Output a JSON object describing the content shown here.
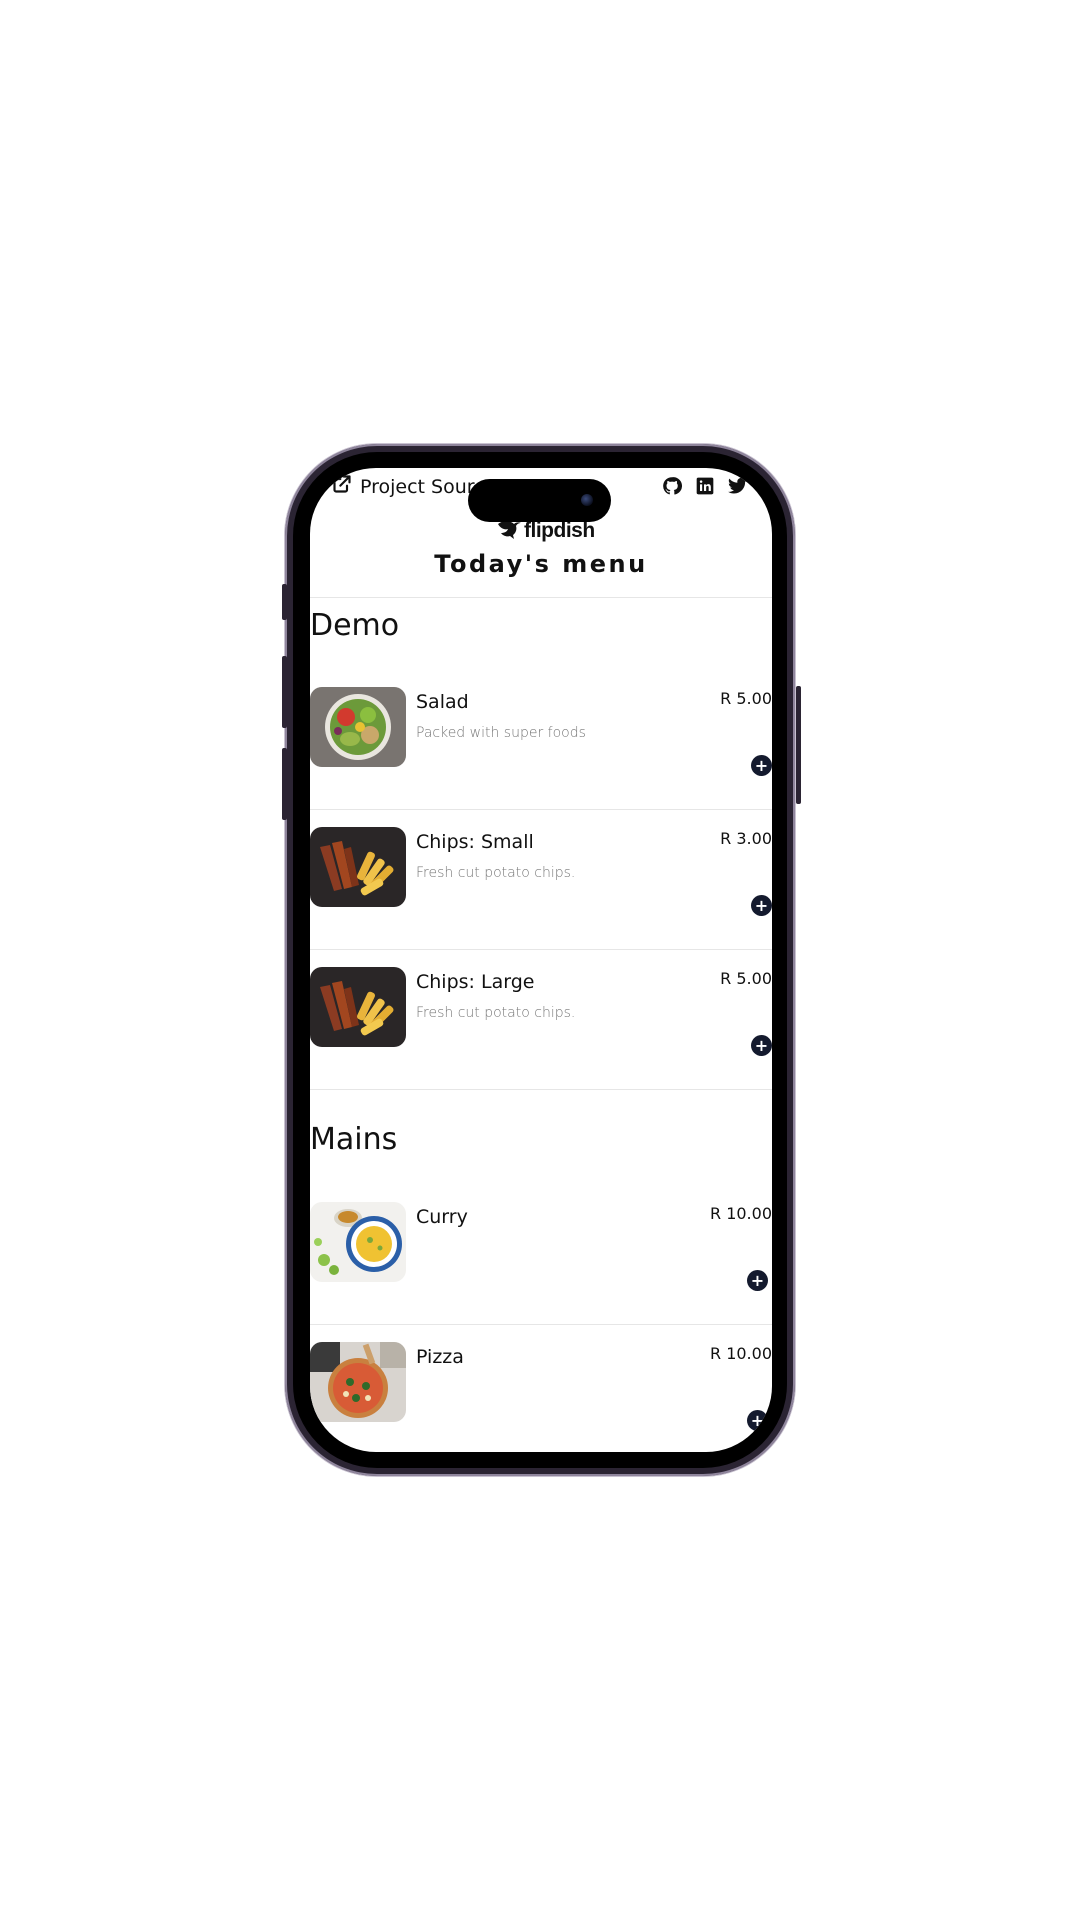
{
  "header": {
    "source_link_label": "Project Source Code",
    "social_icons": [
      "github-icon",
      "linkedin-icon",
      "twitter-icon"
    ],
    "logo_text": "flipdish",
    "title": "Today's menu"
  },
  "sections": [
    {
      "title": "Demo",
      "items": [
        {
          "name": "Salad",
          "description": "Packed with super foods",
          "price": "R 5.00",
          "image": "salad-image"
        },
        {
          "name": "Chips: Small",
          "description": "Fresh cut potato chips.",
          "price": "R 3.00",
          "image": "chips-image"
        },
        {
          "name": "Chips: Large",
          "description": "Fresh cut potato chips.",
          "price": "R 5.00",
          "image": "chips-image"
        }
      ]
    },
    {
      "title": "Mains",
      "items": [
        {
          "name": "Curry",
          "description": "",
          "price": "R 10.00",
          "image": "curry-image"
        },
        {
          "name": "Pizza",
          "description": "",
          "price": "R 10.00",
          "image": "pizza-image"
        }
      ]
    }
  ],
  "add_button_symbol": "+",
  "colors": {
    "frame": "#2b2433",
    "add_button": "#141a2e",
    "description_text": "#777777"
  }
}
